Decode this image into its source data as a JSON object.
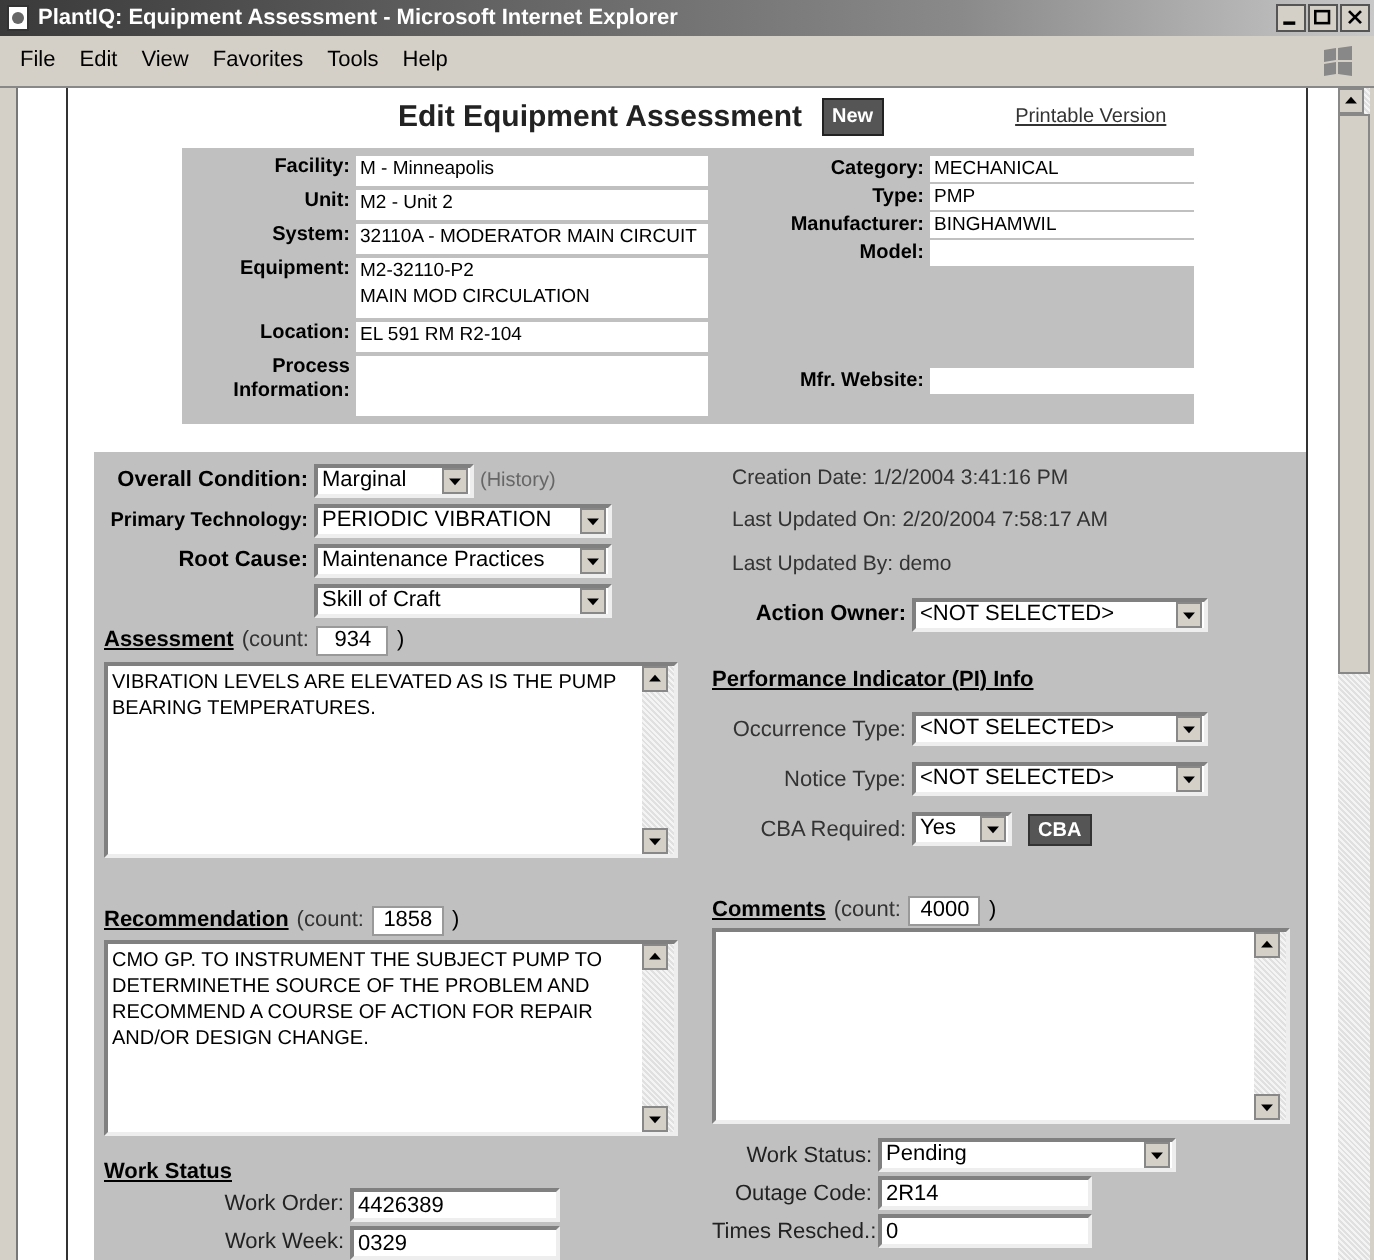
{
  "window": {
    "title": "PlantIQ: Equipment Assessment - Microsoft Internet Explorer"
  },
  "menu": [
    "File",
    "Edit",
    "View",
    "Favorites",
    "Tools",
    "Help"
  ],
  "page": {
    "title": "Edit Equipment Assessment",
    "badge": "New",
    "printable_link": "Printable Version"
  },
  "equipment": {
    "left": [
      {
        "label": "Facility:",
        "value": "M - Minneapolis"
      },
      {
        "label": "Unit:",
        "value": "M2 - Unit 2"
      },
      {
        "label": "System:",
        "value": "32110A - MODERATOR MAIN CIRCUIT"
      },
      {
        "label": "Equipment:",
        "value": "M2-32110-P2\nMAIN MOD CIRCULATION",
        "kind": "tall"
      },
      {
        "label": "Location:",
        "value": "EL 591 RM R2-104"
      },
      {
        "label": "Process Information:",
        "kind": "tall"
      }
    ],
    "right": [
      {
        "label": "Category:",
        "value": "MECHANICAL"
      },
      {
        "label": "Type:",
        "value": "PMP"
      },
      {
        "label": "Manufacturer:",
        "value": "BINGHAMWIL"
      },
      {
        "label": "Model:"
      },
      {
        "label": "Mfr. Website:",
        "kind": "spaced"
      }
    ]
  },
  "assessment": {
    "overall_condition": {
      "label": "Overall Condition:",
      "value": "Marginal",
      "history_link": "(History)"
    },
    "primary_technology": {
      "label": "Primary Technology:",
      "value": "PERIODIC VIBRATION"
    },
    "root_cause": {
      "label": "Root Cause:",
      "values": [
        "Maintenance Practices",
        "Skill of Craft"
      ]
    },
    "info": [
      "Creation Date: 1/2/2004 3:41:16 PM",
      "Last Updated On: 2/20/2004 7:58:17 AM",
      "Last Updated By: demo"
    ],
    "action_owner": {
      "label": "Action Owner:",
      "value": "<NOT SELECTED>"
    },
    "assessment_text": {
      "label": "Assessment",
      "count_label": "(count:",
      "count": "934",
      "count_close": ")",
      "text": "VIBRATION LEVELS ARE ELEVATED AS IS THE PUMP BEARING TEMPERATURES."
    },
    "pi": {
      "heading": "Performance Indicator (PI) Info",
      "occurrence": {
        "label": "Occurrence Type:",
        "value": "<NOT SELECTED>"
      },
      "notice": {
        "label": "Notice Type:",
        "value": "<NOT SELECTED>"
      },
      "cba": {
        "label": "CBA Required:",
        "value": "Yes",
        "button": "CBA"
      }
    },
    "recommendation": {
      "label": "Recommendation",
      "count_label": "(count:",
      "count": "1858",
      "count_close": ")",
      "text": "CMO GP. TO INSTRUMENT THE SUBJECT PUMP TO DETERMINETHE SOURCE OF THE PROBLEM AND RECOMMEND A COURSE OF ACTION FOR REPAIR AND/OR DESIGN CHANGE."
    },
    "comments": {
      "label": "Comments",
      "count_label": "(count:",
      "count": "4000",
      "count_close": ")"
    }
  },
  "work_status": {
    "heading": "Work Status",
    "left": [
      {
        "label": "Work Order:",
        "value": "4426389"
      },
      {
        "label": "Work Week:",
        "value": "0329"
      }
    ],
    "right": [
      {
        "label": "Work Status:",
        "value": "Pending",
        "kind": "select"
      },
      {
        "label": "Outage Code:",
        "value": "2R14",
        "kind": "input"
      },
      {
        "label": "Times Resched.:",
        "value": "0",
        "kind": "input"
      }
    ]
  }
}
